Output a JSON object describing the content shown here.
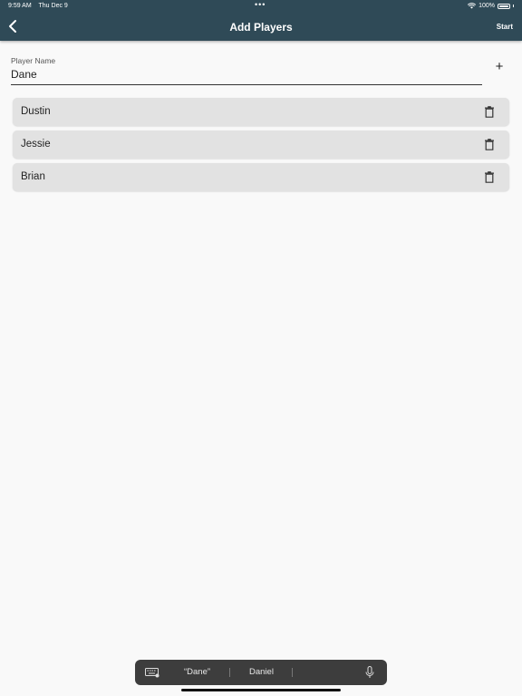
{
  "status_bar": {
    "time": "9:59 AM",
    "date": "Thu Dec 9",
    "battery": "100%"
  },
  "nav": {
    "title": "Add Players",
    "start_label": "Start"
  },
  "form": {
    "label": "Player Name",
    "value": "Dane",
    "add_symbol": "+"
  },
  "players": [
    {
      "name": "Dustin"
    },
    {
      "name": "Jessie"
    },
    {
      "name": "Brian"
    }
  ],
  "keyboard": {
    "suggestions": [
      "“Dane”",
      "Daniel"
    ]
  },
  "colors": {
    "header": "#2f4a57",
    "row": "#e2e2e2",
    "background": "#f9f9f9"
  },
  "icons": {
    "back": "chevron-left-icon",
    "add": "plus-icon",
    "delete": "trash-icon",
    "keyboard": "keyboard-icon",
    "mic": "microphone-icon"
  }
}
